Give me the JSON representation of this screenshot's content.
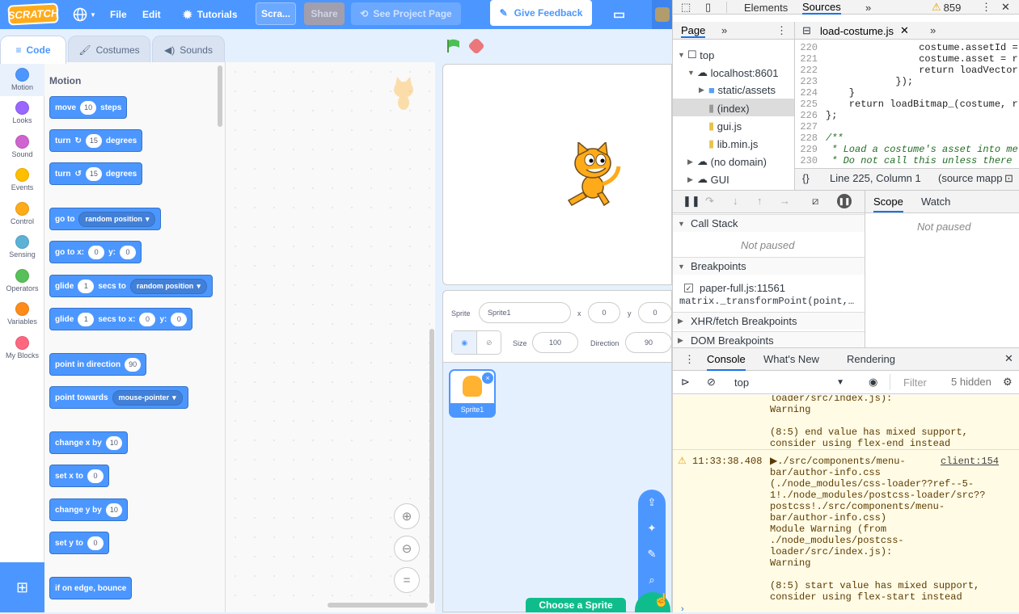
{
  "menubar": {
    "logo": "SCRATCH",
    "file": "File",
    "edit": "Edit",
    "tutorials": "Tutorials",
    "project_title": "Scra...",
    "share": "Share",
    "see_project": "See Project Page",
    "give_feedback": "Give Feedback"
  },
  "tabs": {
    "code": "Code",
    "costumes": "Costumes",
    "sounds": "Sounds"
  },
  "categories": [
    {
      "label": "Motion",
      "color": "#4c97ff"
    },
    {
      "label": "Looks",
      "color": "#9966ff"
    },
    {
      "label": "Sound",
      "color": "#cf63cf"
    },
    {
      "label": "Events",
      "color": "#ffbf00"
    },
    {
      "label": "Control",
      "color": "#ffab19"
    },
    {
      "label": "Sensing",
      "color": "#5cb1d6"
    },
    {
      "label": "Operators",
      "color": "#59c059"
    },
    {
      "label": "Variables",
      "color": "#ff8c1a"
    },
    {
      "label": "My Blocks",
      "color": "#ff6680"
    }
  ],
  "palette": {
    "title": "Motion",
    "move": {
      "a": "move",
      "v": "10",
      "b": "steps"
    },
    "turn_right": {
      "a": "turn",
      "v": "15",
      "b": "degrees"
    },
    "turn_left": {
      "a": "turn",
      "v": "15",
      "b": "degrees"
    },
    "go_to": {
      "a": "go to",
      "d": "random position"
    },
    "go_to_xy": {
      "a": "go to x:",
      "x": "0",
      "b": "y:",
      "y": "0"
    },
    "glide_to": {
      "a": "glide",
      "v": "1",
      "b": "secs to",
      "d": "random position"
    },
    "glide_xy": {
      "a": "glide",
      "v": "1",
      "b": "secs to x:",
      "x": "0",
      "c": "y:",
      "y": "0"
    },
    "point_dir": {
      "a": "point in direction",
      "v": "90"
    },
    "point_towards": {
      "a": "point towards",
      "d": "mouse-pointer"
    },
    "change_x": {
      "a": "change x by",
      "v": "10"
    },
    "set_x": {
      "a": "set x to",
      "v": "0"
    },
    "change_y": {
      "a": "change y by",
      "v": "10"
    },
    "set_y": {
      "a": "set y to",
      "v": "0"
    },
    "bounce": {
      "a": "if on edge, bounce"
    }
  },
  "sprite_info": {
    "sprite_label": "Sprite",
    "sprite_name": "Sprite1",
    "x_label": "x",
    "x": "0",
    "y_label": "y",
    "y": "0",
    "size_label": "Size",
    "size": "100",
    "direction_label": "Direction",
    "direction": "90"
  },
  "sprite_list": {
    "sprite1": "Sprite1",
    "choose": "Choose a Sprite"
  },
  "devtools": {
    "tabs": {
      "elements": "Elements",
      "sources": "Sources"
    },
    "warnings": "859",
    "page_tab": "Page",
    "file_tab": "load-costume.js",
    "tree": {
      "top": "top",
      "host": "localhost:8601",
      "static": "static/assets",
      "index": "(index)",
      "gui": "gui.js",
      "lib": "lib.min.js",
      "nodomain": "(no domain)",
      "gui_folder": "GUI"
    },
    "code": [
      {
        "n": "220",
        "t": "                costume.assetId ="
      },
      {
        "n": "221",
        "t": "                costume.asset = r"
      },
      {
        "n": "222",
        "t": "                return loadVector"
      },
      {
        "n": "223",
        "t": "            });"
      },
      {
        "n": "224",
        "t": "    }"
      },
      {
        "n": "225",
        "t": "    return loadBitmap_(costume, r"
      },
      {
        "n": "226",
        "t": "};"
      },
      {
        "n": "227",
        "t": ""
      },
      {
        "n": "228",
        "t": "/**"
      },
      {
        "n": "229",
        "t": " * Load a costume's asset into me"
      },
      {
        "n": "230",
        "t": " * Do not call this unless there"
      }
    ],
    "status": {
      "position": "Line 225, Column 1",
      "mapped": "(source mapp"
    },
    "scope": "Scope",
    "watch": "Watch",
    "not_paused_scope": "Not paused",
    "call_stack": "Call Stack",
    "not_paused": "Not paused",
    "breakpoints": "Breakpoints",
    "bp_file": "paper-full.js:11561",
    "bp_code": "matrix._transformPoint(point,…",
    "xhr": "XHR/fetch Breakpoints",
    "dom": "DOM Breakpoints",
    "drawer_tabs": {
      "console": "Console",
      "whatsnew": "What's New",
      "rendering": "Rendering"
    },
    "context": "top",
    "filter": "Filter",
    "hidden": "5 hidden",
    "console_lines_a": [
      "loader/src/index.js):",
      "Warning",
      "",
      "(8:5) end value has mixed support,",
      "consider using flex-end instead"
    ],
    "time": "11:33:38.408",
    "msg_first": "▶./src/components/menu-",
    "link": "client:154",
    "console_lines_b": [
      "bar/author-info.css",
      "(./node_modules/css-loader??ref--5-",
      "1!./node_modules/postcss-loader/src??",
      "postcss!./src/components/menu-",
      "bar/author-info.css)",
      "Module Warning (from",
      "./node_modules/postcss-",
      "loader/src/index.js):",
      "Warning",
      "",
      "(8:5) start value has mixed support,",
      "consider using flex-start instead"
    ]
  }
}
